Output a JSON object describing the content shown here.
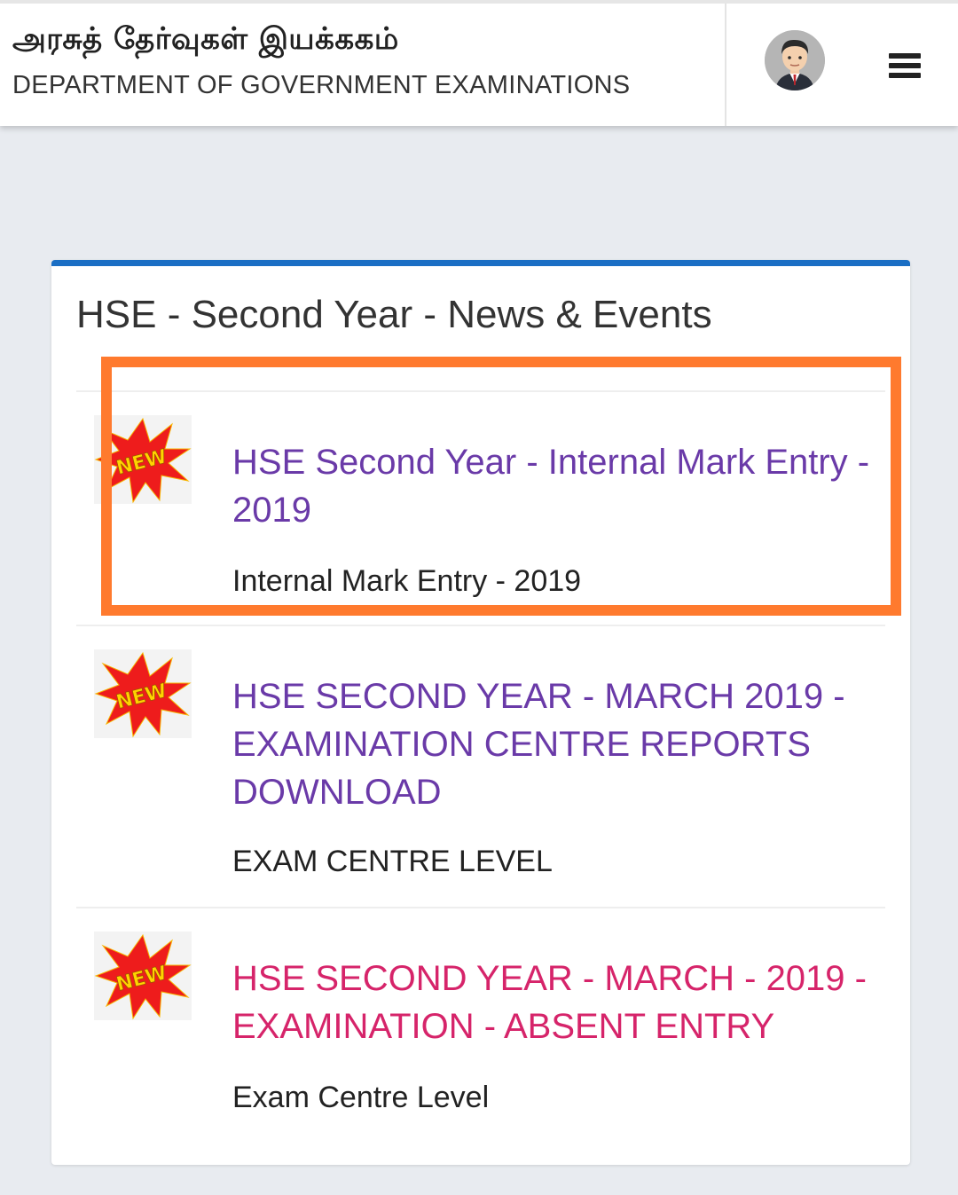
{
  "header": {
    "title_tamil": "அரசுத் தேர்வுகள் இயக்ககம்",
    "title_english": "DEPARTMENT OF GOVERNMENT EXAMINATIONS",
    "avatar": "user-avatar",
    "menu_icon": "hamburger-menu-icon"
  },
  "colors": {
    "accent_bar": "#1a6ec4",
    "link_purple": "#6a3aa8",
    "link_red": "#d6246a",
    "highlight_orange": "#ff7a2e"
  },
  "panel": {
    "title": "HSE - Second Year - News & Events",
    "items": [
      {
        "badge": "NEW",
        "link": "HSE Second Year - Internal Mark Entry - 2019",
        "subtitle": "Internal Mark Entry - 2019",
        "link_color": "purple"
      },
      {
        "badge": "NEW",
        "link": "HSE SECOND YEAR - MARCH 2019 - EXAMINATION CENTRE REPORTS DOWNLOAD",
        "subtitle": "EXAM CENTRE LEVEL",
        "link_color": "purple"
      },
      {
        "badge": "NEW",
        "link": "HSE SECOND YEAR - MARCH - 2019 - EXAMINATION - ABSENT ENTRY",
        "subtitle": "Exam Centre Level",
        "link_color": "red"
      }
    ]
  }
}
